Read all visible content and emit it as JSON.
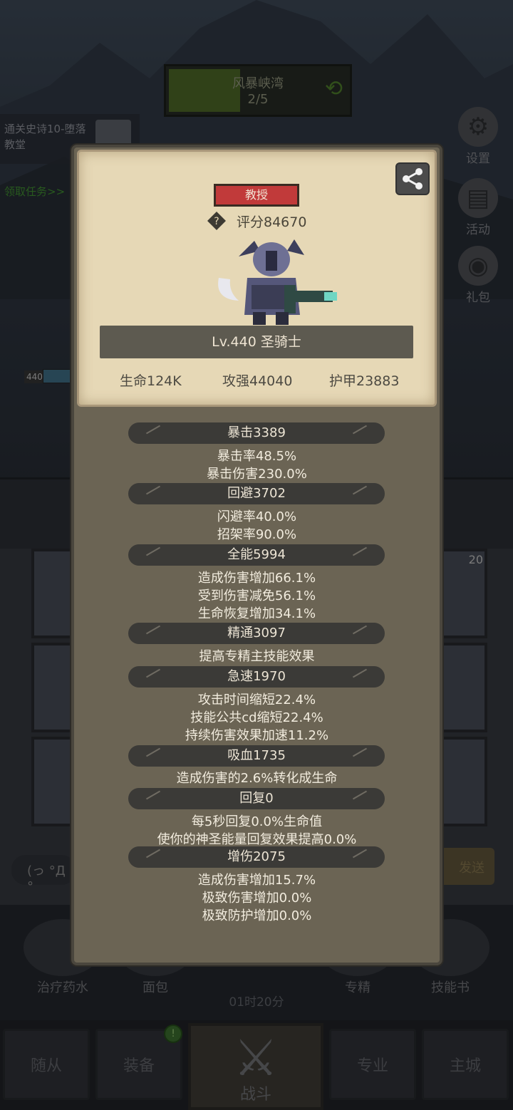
{
  "background": {
    "zone": {
      "name": "风暴峡湾",
      "progress": "2/5",
      "progress_fraction": 0.4
    },
    "quest": {
      "text": "通关史诗10-堕落教堂",
      "link": "领取任务>>"
    },
    "side_buttons": [
      "设置",
      "活动",
      "礼包"
    ],
    "character": {
      "level": "440",
      "hp_partial": "18"
    },
    "slot_count": "20",
    "chat_placeholder": "(っ °Д °",
    "send_label": "发送",
    "tools": [
      "治疗药水",
      "面包",
      "专精",
      "技能书"
    ],
    "timer": "01时20分",
    "nav": {
      "followers": "随从",
      "equipment": "装备",
      "battle": "战斗",
      "profession": "专业",
      "city": "主城"
    },
    "nav_badge": "!"
  },
  "card": {
    "title": "教授",
    "rating": "评分84670",
    "level_class": "Lv.440 圣骑士",
    "hp": "生命124K",
    "attack": "攻强44040",
    "armor": "护甲23883"
  },
  "stats": [
    {
      "header": "暴击3389",
      "lines": [
        "暴击率48.5%",
        "暴击伤害230.0%"
      ]
    },
    {
      "header": "回避3702",
      "lines": [
        "闪避率40.0%",
        "招架率90.0%"
      ]
    },
    {
      "header": "全能5994",
      "lines": [
        "造成伤害增加66.1%",
        "受到伤害减免56.1%",
        "生命恢复增加34.1%"
      ]
    },
    {
      "header": "精通3097",
      "lines": [
        "提高专精主技能效果"
      ]
    },
    {
      "header": "急速1970",
      "lines": [
        "攻击时间缩短22.4%",
        "技能公共cd缩短22.4%",
        "持续伤害效果加速11.2%"
      ]
    },
    {
      "header": "吸血1735",
      "lines": [
        "造成伤害的2.6%转化成生命"
      ]
    },
    {
      "header": "回复0",
      "lines": [
        "每5秒回复0.0%生命值",
        "使你的神圣能量回复效果提高0.0%"
      ]
    },
    {
      "header": "增伤2075",
      "lines": [
        "造成伤害增加15.7%",
        "极致伤害增加0.0%",
        "极致防护增加0.0%"
      ]
    }
  ],
  "colors": {
    "title_badge": "#c13a3a",
    "card_bg": "#e6d8b6",
    "panel_bg": "#6b6454",
    "header_pill": "#3b3a37"
  }
}
